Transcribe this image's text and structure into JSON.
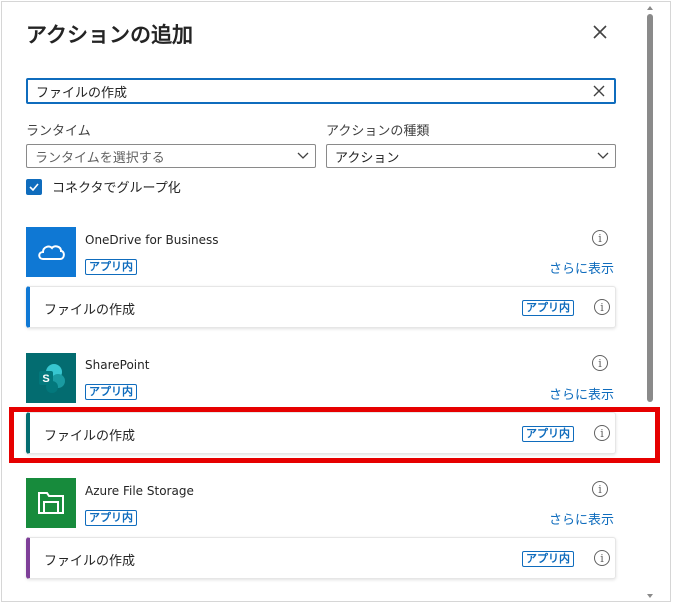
{
  "panel": {
    "title": "アクションの追加",
    "close_icon": "close-icon"
  },
  "search": {
    "value": "ファイルの作成",
    "clear_icon": "clear-icon"
  },
  "filters": {
    "runtime_label": "ランタイム",
    "runtime_placeholder": "ランタイムを選択する",
    "action_type_label": "アクションの種類",
    "action_type_value": "アクション"
  },
  "group_by_connector": {
    "label": "コネクタでグループ化",
    "checked": true
  },
  "connectors": [
    {
      "name": "OneDrive for Business",
      "badge": "アプリ内",
      "more": "さらに表示",
      "icon": "onedrive-icon",
      "color": "#0f78d4",
      "actions": [
        {
          "label": "ファイルの作成",
          "badge": "アプリ内"
        }
      ]
    },
    {
      "name": "SharePoint",
      "badge": "アプリ内",
      "more": "さらに表示",
      "icon": "sharepoint-icon",
      "color": "#036c70",
      "actions": [
        {
          "label": "ファイルの作成",
          "badge": "アプリ内"
        }
      ]
    },
    {
      "name": "Azure File Storage",
      "badge": "アプリ内",
      "more": "さらに表示",
      "icon": "azure-file-storage-icon",
      "color": "#178b3c",
      "actions": [
        {
          "label": "ファイルの作成",
          "badge": "アプリ内"
        }
      ]
    }
  ],
  "colors": {
    "accent": "#0f6cbd",
    "highlight": "#e60000"
  }
}
